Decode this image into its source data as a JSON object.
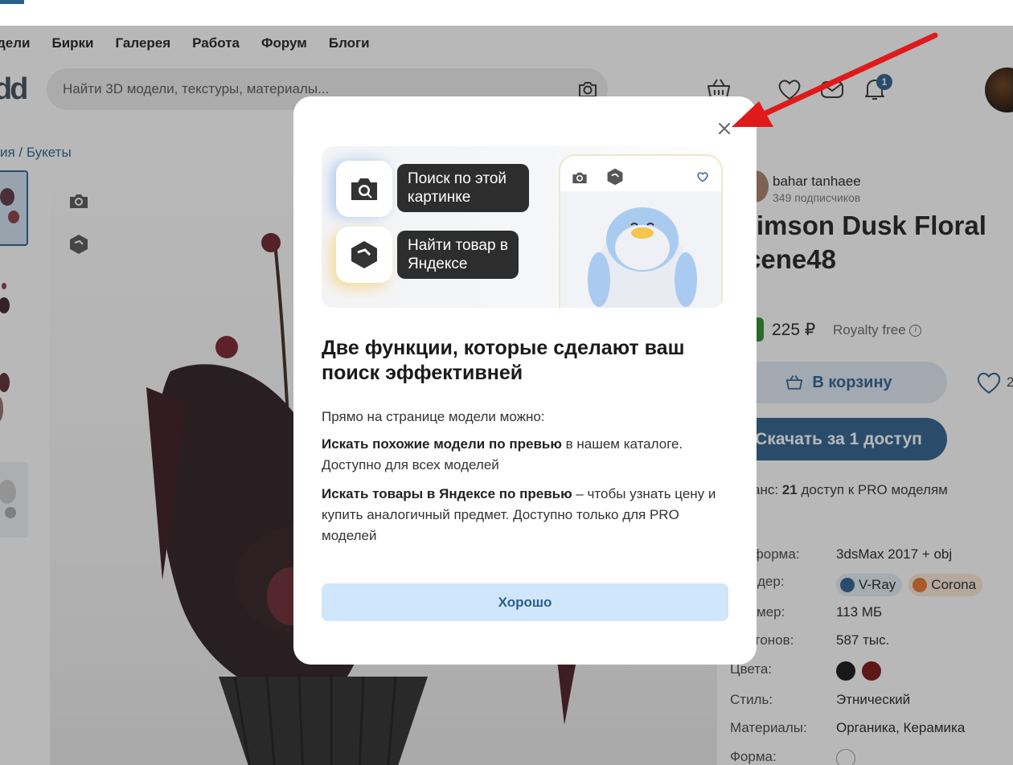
{
  "nav": {
    "items": [
      "дели",
      "Бирки",
      "Галерея",
      "Работа",
      "Форум",
      "Блоги"
    ]
  },
  "logo": {
    "text": "dd"
  },
  "search": {
    "placeholder": "Найти 3D модели, текстуры, материалы..."
  },
  "header": {
    "notifications_count": "1"
  },
  "breadcrumb": {
    "text": "ия / Букеты"
  },
  "product": {
    "author": "bahar tanhaee",
    "subscribers": "349 подписчиков",
    "title": "rimson Dusk Floral\ncene48",
    "price": "225 ₽",
    "license": "Royalty free",
    "cart_label": "В корзину",
    "favorites_count": "2",
    "download_label": "Скачать за 1 доступ",
    "balance_prefix": "анс:",
    "balance_count": "21",
    "balance_suffix": "доступ к PRO моделям",
    "specs": {
      "platform_key": "тформа:",
      "platform_val": "3dsMax 2017 + obj",
      "render_key": "дер:",
      "render_vray": "V-Ray",
      "render_corona": "Corona",
      "size_key": "мер:",
      "size_val": "113 МБ",
      "polys_key": "игонов:",
      "polys_val": "587 тыс.",
      "colors_key": "Цвета:",
      "color_1": "#111111",
      "color_2": "#7a0f0f",
      "style_key": "Стиль:",
      "style_val": "Этнический",
      "materials_key": "Материалы:",
      "materials_val": "Органика, Керамика",
      "shape_key": "Форма:"
    }
  },
  "modal": {
    "feature_search_label": "Поиск по этой картинке",
    "feature_yandex_label": "Найти товар в Яндексе",
    "title": "Две функции, которые сделают ваш поиск эффективней",
    "intro": "Прямо на странице модели можно:",
    "p1_bold": "Искать похожие модели по превью",
    "p1_rest": " в нашем каталоге. Доступно для всех моделей",
    "p2_bold": "Искать товары в Яндексе по превью",
    "p2_rest": " – чтобы узнать цену и купить аналогичный предмет. Доступно только для PRO моделей",
    "ok_label": "Хорошо"
  },
  "colors": {
    "accent": "#2b5f8c",
    "annotation_arrow": "#e0191b",
    "ok_button_bg": "#cfe6fb"
  },
  "icons": [
    "camera-icon",
    "cube-icon",
    "basket-icon",
    "heart-icon",
    "mail-icon",
    "bell-icon",
    "close-icon",
    "info-icon"
  ]
}
